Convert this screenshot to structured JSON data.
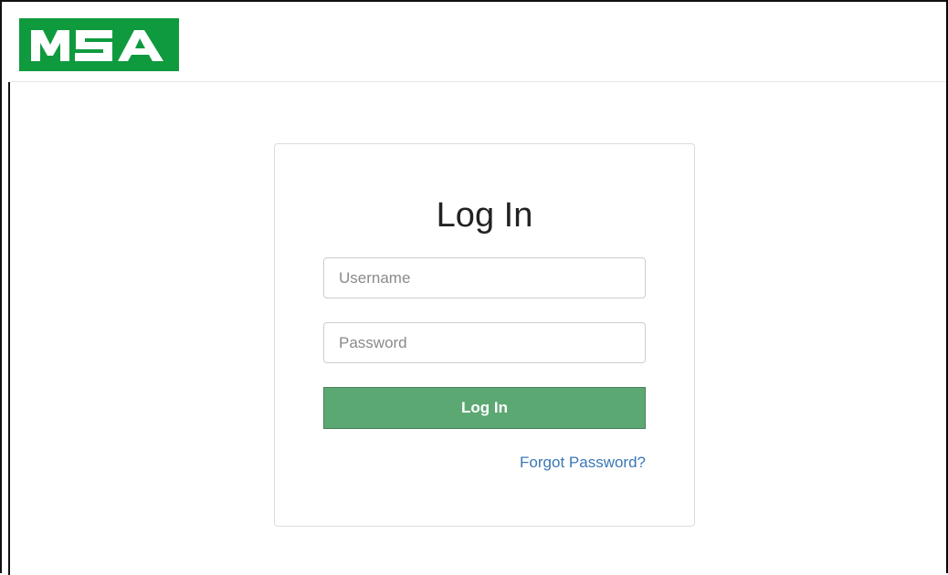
{
  "header": {
    "logo_text": "MSA",
    "logo_color": "#0f9a3e"
  },
  "login": {
    "title": "Log In",
    "username_placeholder": "Username",
    "username_value": "",
    "password_placeholder": "Password",
    "password_value": "",
    "submit_label": "Log In",
    "submit_color": "#5ca873",
    "forgot_label": "Forgot Password?",
    "link_color": "#3b78b5"
  }
}
